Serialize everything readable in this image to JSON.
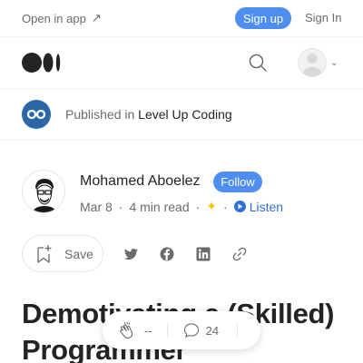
{
  "topbar": {
    "open_in_app": "Open in app",
    "open_in_app_icon": "arrow-up-right-icon",
    "sign_up": "Sign up",
    "sign_in": "Sign In"
  },
  "navbar": {
    "logo": "medium-logo",
    "search_icon": "search-icon"
  },
  "publication": {
    "prefix": "Published in",
    "name": "Level Up Coding"
  },
  "author": {
    "name": "Mohamed Aboelez",
    "follow_label": "Follow"
  },
  "meta": {
    "date": "Mar 8",
    "dot1": "·",
    "read_time": "4 min read",
    "dot2": "·",
    "dot3": "·",
    "listen_label": "Listen"
  },
  "actions": {
    "save_label": "Save",
    "share_icons": [
      "twitter-icon",
      "facebook-icon",
      "linkedin-icon",
      "link-icon"
    ]
  },
  "article": {
    "title": "Demotivating a (Skilled) Programmer"
  },
  "floating_bar": {
    "clap_count": "--",
    "response_count": "24"
  },
  "colors": {
    "accent": "#4d8ef0",
    "listen": "#2e6fd8",
    "publication_logo": "#2c68a8",
    "member_star": "#f2c200"
  }
}
